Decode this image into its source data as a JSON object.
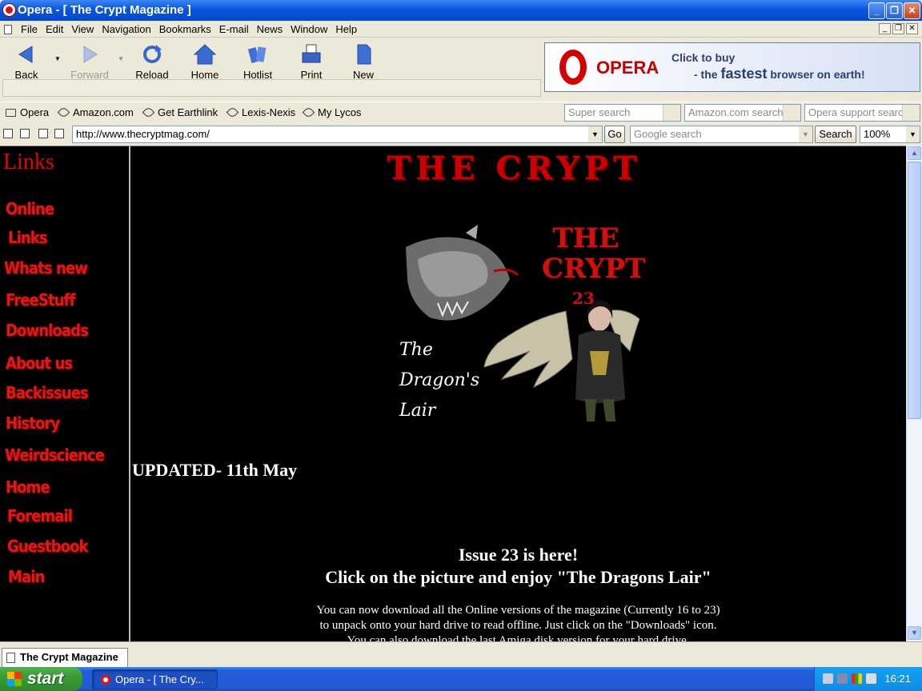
{
  "window": {
    "title": "Opera - [ The Crypt Magazine ]",
    "controls": [
      "minimize",
      "restore",
      "close"
    ]
  },
  "menu": [
    "File",
    "Edit",
    "View",
    "Navigation",
    "Bookmarks",
    "E-mail",
    "News",
    "Window",
    "Help"
  ],
  "toolbar": {
    "back": "Back",
    "forward": "Forward",
    "reload": "Reload",
    "home": "Home",
    "hotlist": "Hotlist",
    "print": "Print",
    "new": "New"
  },
  "ad": {
    "brand": "OPERA",
    "line1": "Click to buy",
    "line2_pre": "- the ",
    "line2_bold": "fastest",
    "line2_post": " browser on earth!"
  },
  "personal_bar": {
    "items": [
      "Opera",
      "Amazon.com",
      "Get Earthlink",
      "Lexis-Nexis",
      "My Lycos"
    ],
    "search1": "Super search",
    "search2": "Amazon.com search",
    "search3": "Opera support search"
  },
  "address_bar": {
    "url": "http://www.thecryptmag.com/",
    "go": "Go",
    "google_placeholder": "Google search",
    "search": "Search",
    "zoom": "100%"
  },
  "page": {
    "sidebar_title": "Links",
    "nav": [
      "Online",
      "Links",
      "Whats new",
      "FreeStuff",
      "Downloads",
      "About us",
      "Backissues",
      "History",
      "Weirdscience",
      "Home",
      "Foremail",
      "Guestbook",
      "Main"
    ],
    "site_title": "THE CRYPT",
    "cover": {
      "title_line1": "THE",
      "title_line2": "CRYPT",
      "issue_number": "23",
      "subtitle_1": "The",
      "subtitle_2": "Dragon's",
      "subtitle_3": "Lair"
    },
    "updated": "UPDATED- 11th May",
    "issue_headline": "Issue 23 is here!",
    "click_headline": "Click on the picture and enjoy \"The Dragons Lair\"",
    "body_line1": "You can now download all the Online versions of the magazine (Currently 16 to 23)",
    "body_line2": "to unpack onto your hard drive to read offline. Just click on the \"Downloads\" icon.",
    "body_line3": "You can also download the last Amiga disk version for your hard drive."
  },
  "tab": {
    "label": "The Crypt Magazine"
  },
  "taskbar": {
    "start": "start",
    "task": "Opera - [ The Cry...",
    "clock": "16:21"
  }
}
